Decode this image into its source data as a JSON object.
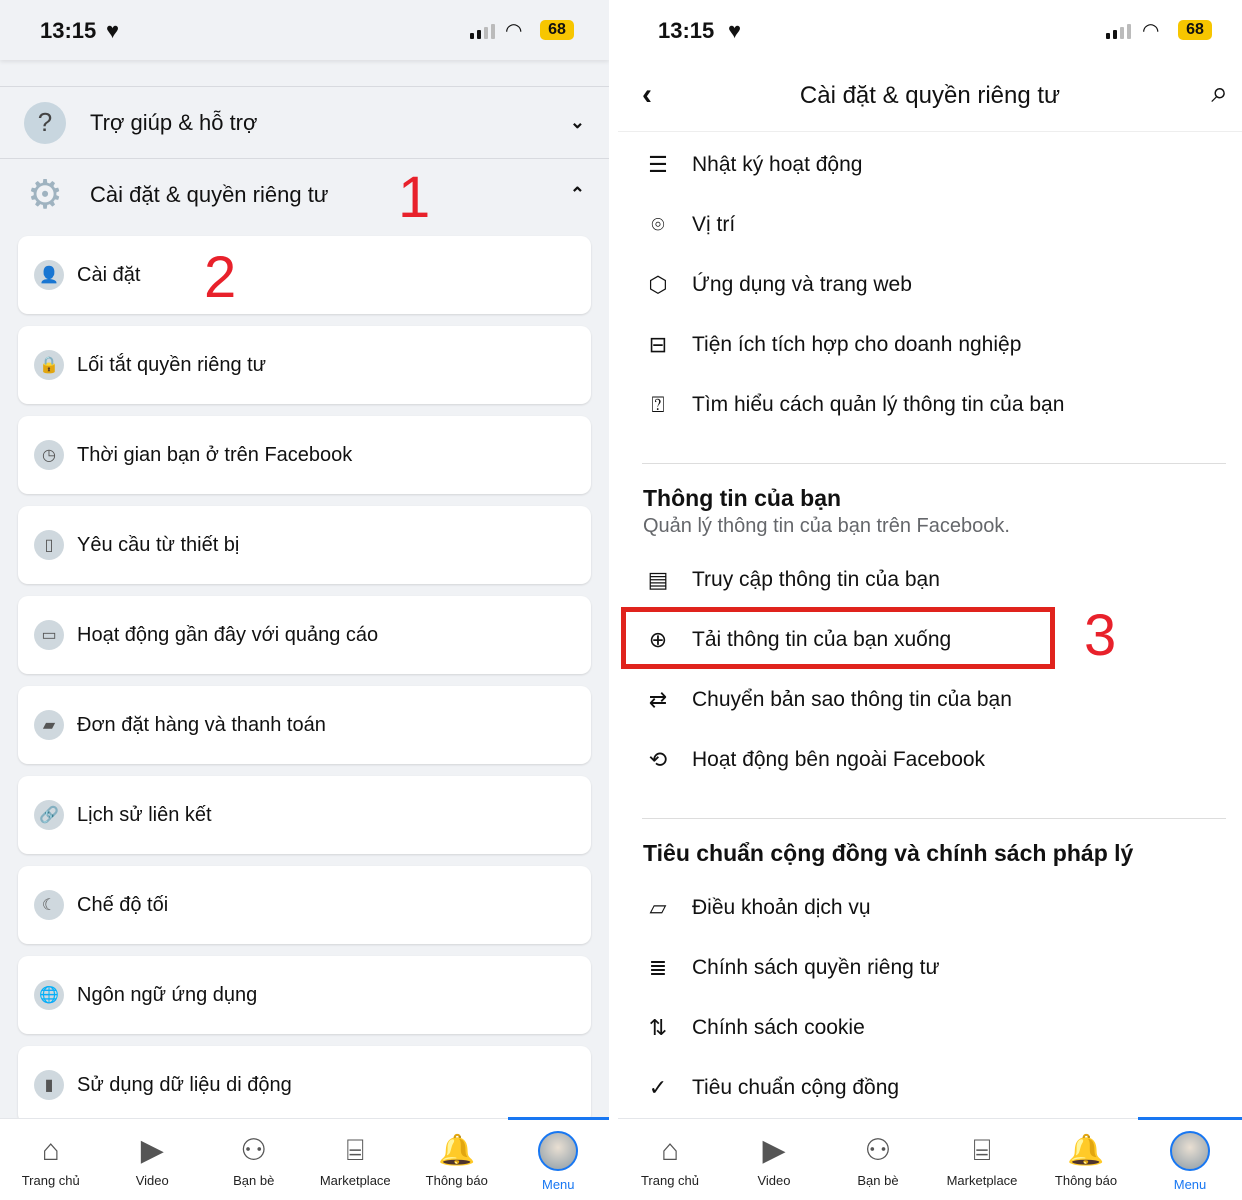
{
  "status": {
    "time": "13:15",
    "battery": "68"
  },
  "left": {
    "sections": [
      {
        "label": "Trợ giúp & hỗ trợ",
        "icon": "help-icon",
        "expanded": false
      },
      {
        "label": "Cài đặt & quyền riêng tư",
        "icon": "gear-icon",
        "expanded": true
      }
    ],
    "annotations": [
      "1",
      "2"
    ],
    "items": [
      {
        "label": "Cài đặt",
        "icon": "user-icon"
      },
      {
        "label": "Lối tắt quyền riêng tư",
        "icon": "lock-icon"
      },
      {
        "label": "Thời gian bạn ở trên Facebook",
        "icon": "clock-icon"
      },
      {
        "label": "Yêu cầu từ thiết bị",
        "icon": "device-key-icon"
      },
      {
        "label": "Hoạt động gần đây với quảng cáo",
        "icon": "ad-image-icon"
      },
      {
        "label": "Đơn đặt hàng và thanh toán",
        "icon": "card-icon"
      },
      {
        "label": "Lịch sử liên kết",
        "icon": "link-icon"
      },
      {
        "label": "Chế độ tối",
        "icon": "moon-icon"
      },
      {
        "label": "Ngôn ngữ ứng dụng",
        "icon": "globe-icon"
      },
      {
        "label": "Sử dụng dữ liệu di động",
        "icon": "phone-icon"
      }
    ]
  },
  "right": {
    "title": "Cài đặt & quyền riêng tư",
    "group1": [
      {
        "label": "Nhật ký hoạt động",
        "icon": "list-icon"
      },
      {
        "label": "Vị trí",
        "icon": "location-pin-icon"
      },
      {
        "label": "Ứng dụng và trang web",
        "icon": "cube-icon"
      },
      {
        "label": "Tiện ích tích hợp cho doanh nghiệp",
        "icon": "briefcase-icon"
      },
      {
        "label": "Tìm hiểu cách quản lý thông tin của bạn",
        "icon": "question-chat-icon"
      }
    ],
    "section2": {
      "title": "Thông tin của bạn",
      "subtitle": "Quản lý thông tin của bạn trên Facebook."
    },
    "group2": [
      {
        "label": "Truy cập thông tin của bạn",
        "icon": "id-card-icon"
      },
      {
        "label": "Tải thông tin của bạn xuống",
        "icon": "download-icon"
      },
      {
        "label": "Chuyển bản sao thông tin của bạn",
        "icon": "folder-transfer-icon"
      },
      {
        "label": "Hoạt động bên ngoài Facebook",
        "icon": "history-icon"
      }
    ],
    "annotation": "3",
    "section3": {
      "title": "Tiêu chuẩn cộng đồng và chính sách pháp lý"
    },
    "group3": [
      {
        "label": "Điều khoản dịch vụ",
        "icon": "book-icon"
      },
      {
        "label": "Chính sách quyền riêng tư",
        "icon": "database-icon"
      },
      {
        "label": "Chính sách cookie",
        "icon": "cookie-icon"
      },
      {
        "label": "Tiêu chuẩn cộng đồng",
        "icon": "badge-check-icon"
      }
    ]
  },
  "nav": [
    {
      "label": "Trang chủ",
      "icon": "home-icon"
    },
    {
      "label": "Video",
      "icon": "video-icon"
    },
    {
      "label": "Bạn bè",
      "icon": "friends-icon"
    },
    {
      "label": "Marketplace",
      "icon": "store-icon"
    },
    {
      "label": "Thông báo",
      "icon": "bell-icon"
    },
    {
      "label": "Menu",
      "icon": "avatar",
      "active": true
    }
  ],
  "colors": {
    "accent": "#1877f2",
    "annotation": "#e0231d",
    "battery": "#f7c600"
  }
}
